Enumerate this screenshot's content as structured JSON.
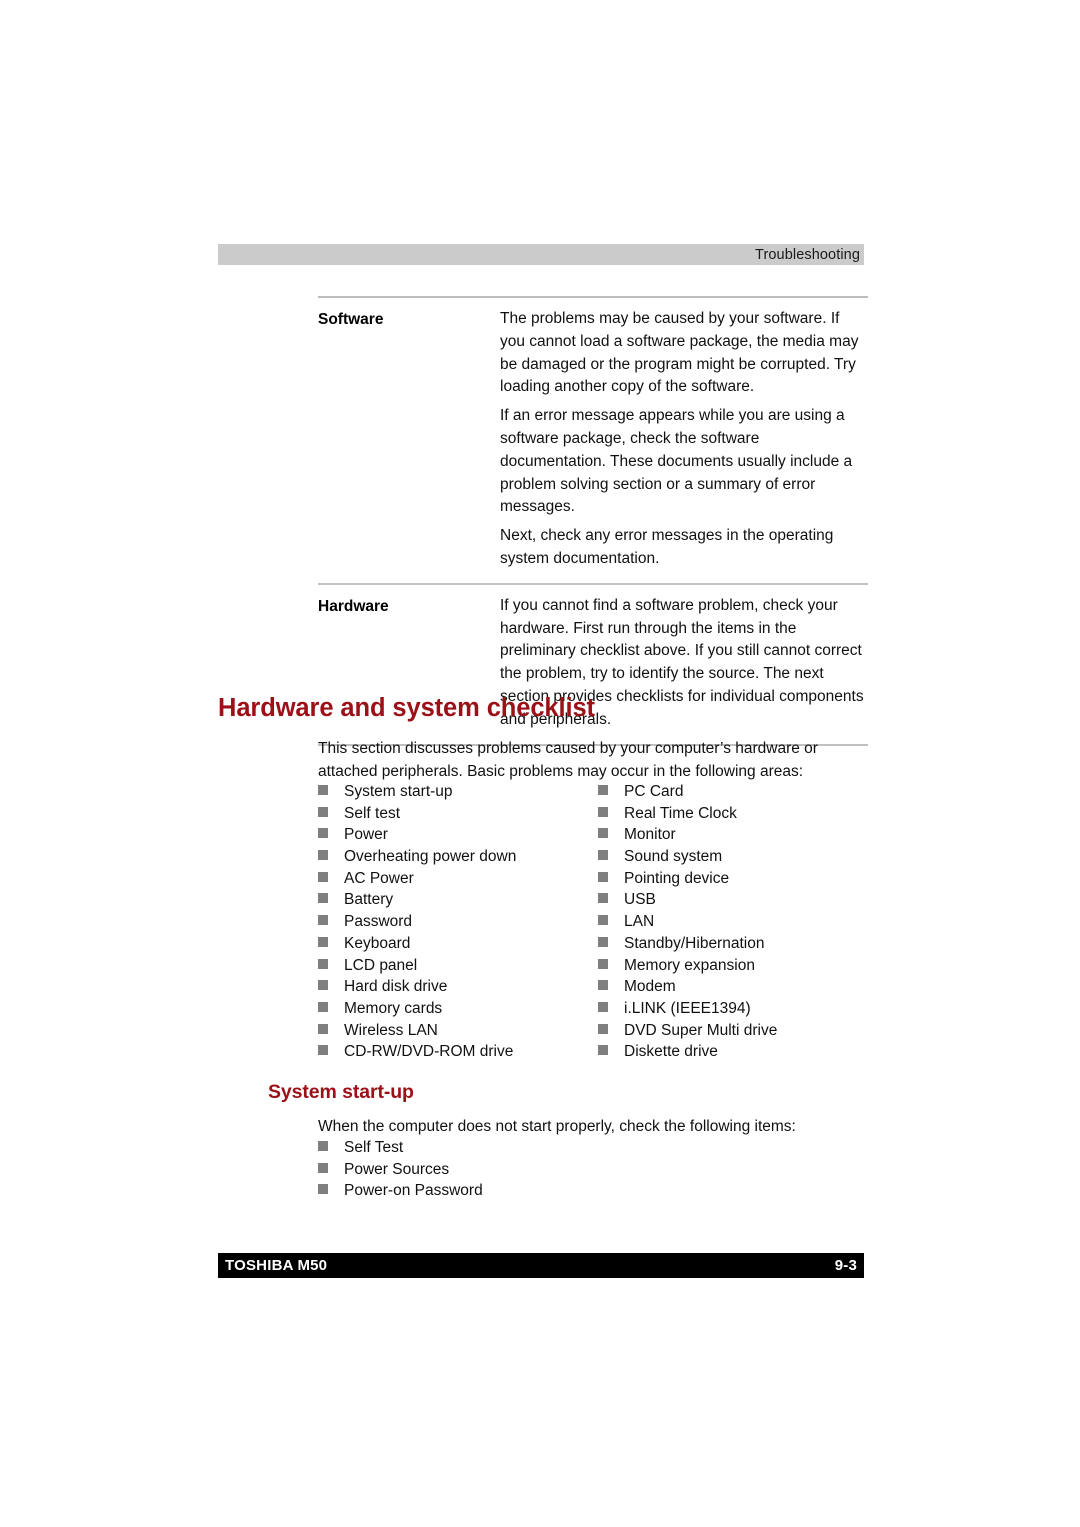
{
  "page": {
    "running_header": "Troubleshooting",
    "footer_left": "TOSHIBA M50",
    "footer_right": "9-3",
    "accent_color": "#9c1018",
    "bullet_color": "#7f7f7f",
    "header_bar_color": "#cbcbcb",
    "footer_bar_color": "#000000"
  },
  "definition_table": {
    "rows": [
      {
        "term": "Software",
        "paragraphs": [
          "The problems may be caused by your software. If you cannot load a software package, the media may be damaged or the program might be corrupted. Try loading another copy of the software.",
          "If an error message appears while you are using a software package, check the software documentation. These documents usually include a problem solving section or a summary of error messages.",
          "Next, check any error messages in the operating system documentation."
        ]
      },
      {
        "term": "Hardware",
        "paragraphs": [
          "If you cannot find a software problem, check your hardware. First run through the items in the preliminary checklist above. If you still cannot correct the problem, try to identify the source. The next section provides checklists for individual components and peripherals."
        ]
      }
    ]
  },
  "section_checklist": {
    "heading": "Hardware and system checklist",
    "intro": "This section discusses problems caused by your computer’s hardware or attached peripherals. Basic problems may occur in the following areas:",
    "column_left": [
      "System start-up",
      "Self test",
      "Power",
      "Overheating power down",
      "AC Power",
      "Battery",
      "Password",
      "Keyboard",
      "LCD panel",
      "Hard disk drive",
      "Memory cards",
      "Wireless LAN",
      "CD-RW/DVD-ROM drive"
    ],
    "column_right": [
      "PC Card",
      "Real Time Clock",
      "Monitor",
      "Sound system",
      "Pointing device",
      "USB",
      "LAN",
      "Standby/Hibernation",
      "Memory expansion",
      "Modem",
      "i.LINK (IEEE1394)",
      "DVD Super Multi drive",
      "Diskette drive"
    ]
  },
  "section_startup": {
    "heading": "System start-up",
    "intro": "When the computer does not start properly, check the following items:",
    "items": [
      "Self Test",
      "Power Sources",
      "Power-on Password"
    ]
  }
}
